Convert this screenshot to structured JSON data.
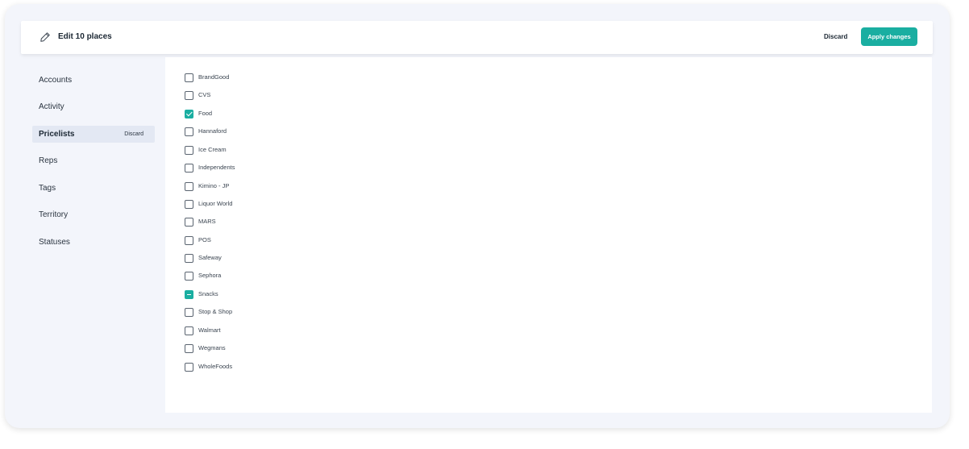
{
  "header": {
    "title": "Edit 10 places",
    "discard_label": "Discard",
    "apply_label": "Apply changes"
  },
  "sidebar": {
    "items": [
      {
        "label": "Accounts",
        "active": false
      },
      {
        "label": "Activity",
        "active": false
      },
      {
        "label": "Pricelists",
        "active": true,
        "discard_label": "Discard"
      },
      {
        "label": "Reps",
        "active": false
      },
      {
        "label": "Tags",
        "active": false
      },
      {
        "label": "Territory",
        "active": false
      },
      {
        "label": "Statuses",
        "active": false
      }
    ]
  },
  "pricelists": [
    {
      "label": "BrandGood",
      "state": "unchecked"
    },
    {
      "label": "CVS",
      "state": "unchecked"
    },
    {
      "label": "Food",
      "state": "checked"
    },
    {
      "label": "Hannaford",
      "state": "unchecked"
    },
    {
      "label": "Ice Cream",
      "state": "unchecked"
    },
    {
      "label": "Independents",
      "state": "unchecked"
    },
    {
      "label": "Kimino - JP",
      "state": "unchecked"
    },
    {
      "label": "Liquor World",
      "state": "unchecked"
    },
    {
      "label": "MARS",
      "state": "unchecked"
    },
    {
      "label": "POS",
      "state": "unchecked"
    },
    {
      "label": "Safeway",
      "state": "unchecked"
    },
    {
      "label": "Sephora",
      "state": "unchecked"
    },
    {
      "label": "Snacks",
      "state": "partial"
    },
    {
      "label": "Stop & Shop",
      "state": "unchecked"
    },
    {
      "label": "Walmart",
      "state": "unchecked"
    },
    {
      "label": "Wegmans",
      "state": "unchecked"
    },
    {
      "label": "WholeFoods",
      "state": "unchecked"
    }
  ],
  "icons": {
    "header": "pencil-icon"
  },
  "colors": {
    "accent": "#1aaea1",
    "active_nav_bg": "#e3e8f3",
    "frame_bg": "#f3f5fb",
    "text": "#1b2733"
  }
}
